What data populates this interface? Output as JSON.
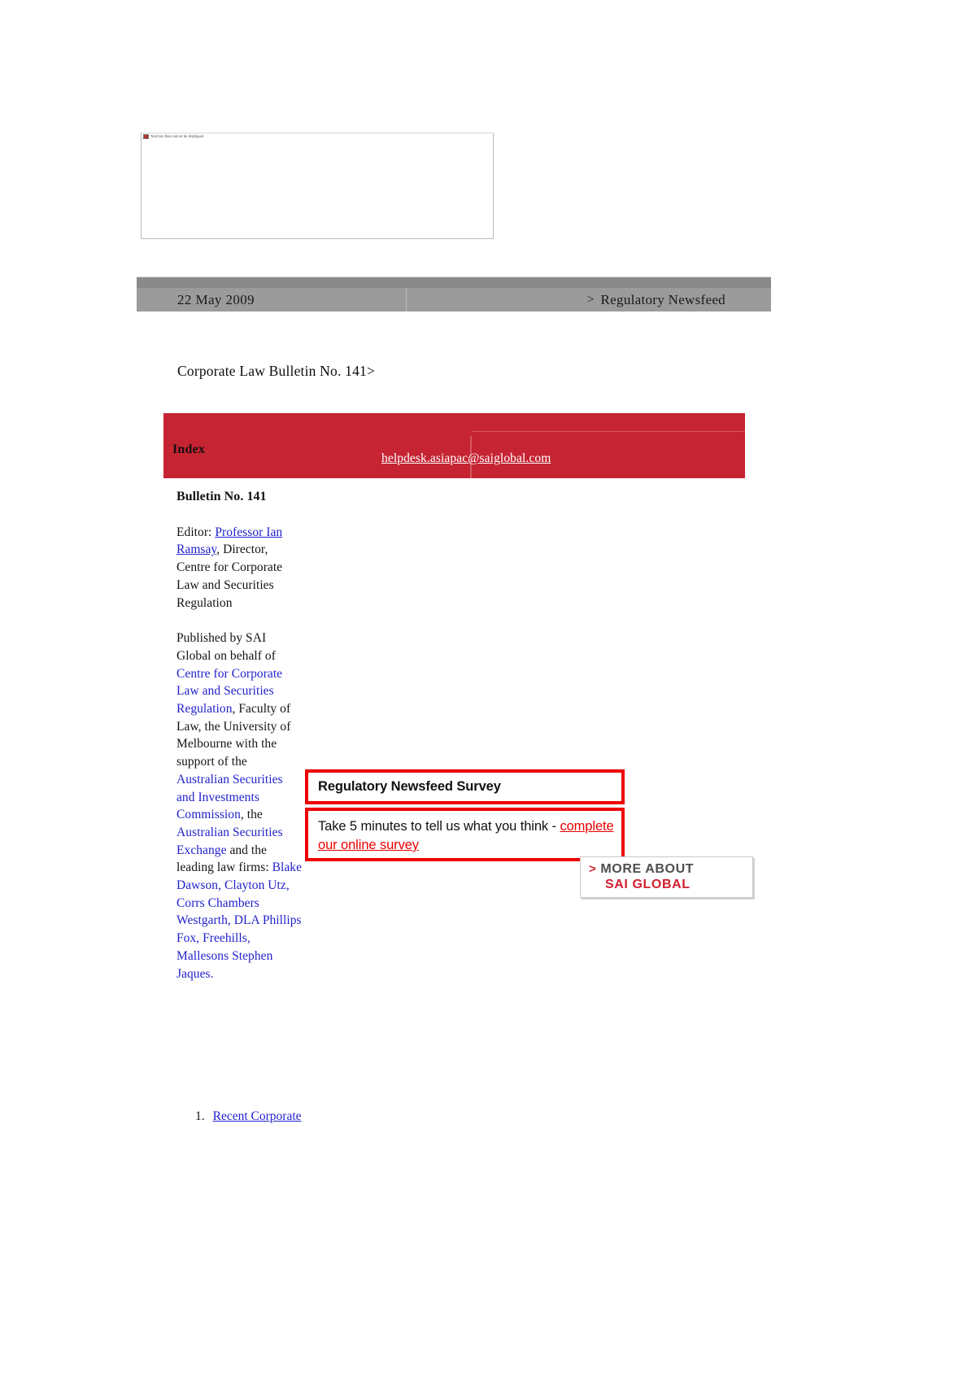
{
  "top_placeholder": {
    "alt_text": "Text box that cannot be displayed",
    "icon": "broken-image-icon"
  },
  "banner": {
    "date": "22 May 2009",
    "arrow": ">",
    "label": "Regulatory Newsfeed"
  },
  "caption": "Corporate Law Bulletin No. 141>",
  "index_table": {
    "index_label": "Index",
    "helpdesk_email": "helpdesk.asiapac@saiglobal.com"
  },
  "sidebar": {
    "bulletin_no": "Bulletin No. 141",
    "editor_prefix": "Editor: ",
    "editor_name": "Professor Ian Ramsay",
    "editor_suffix": ", Director, Centre for Corporate Law and Securities Regulation",
    "published_prefix": "Published by SAI Global on behalf of ",
    "published_org": "Centre for Corporate Law and Securities Regulation",
    "published_mid": ", Faculty of Law, the University of Melbourne with the support of the ",
    "published_org2": "Australian Securities and Investments Commission",
    "published_mid2": ", the ",
    "published_org3": "Australian Securities Exchange",
    "published_mid3": " and the leading law firms: ",
    "published_firms": "Blake Dawson, Clayton Utz, Corrs Chambers Westgarth, DLA Phillips Fox, Freehills, Mallesons Stephen Jaques."
  },
  "index_list": [
    {
      "number": "1.",
      "label": "Recent Corporate"
    }
  ],
  "survey": {
    "heading": "Regulatory Newsfeed Survey",
    "body_prefix": "Take 5 minutes to tell us what you think - ",
    "link_text": "complete our online survey"
  },
  "sai_button": {
    "chevron": ">",
    "line1": "MORE ABOUT",
    "line2": "SAI GLOBAL"
  },
  "colors": {
    "red_header": "#c62432",
    "promo_red": "#ee0000",
    "banner_grey": "#9b9b9b",
    "link_blue": "#2222cc",
    "sai_red": "#d12030"
  }
}
